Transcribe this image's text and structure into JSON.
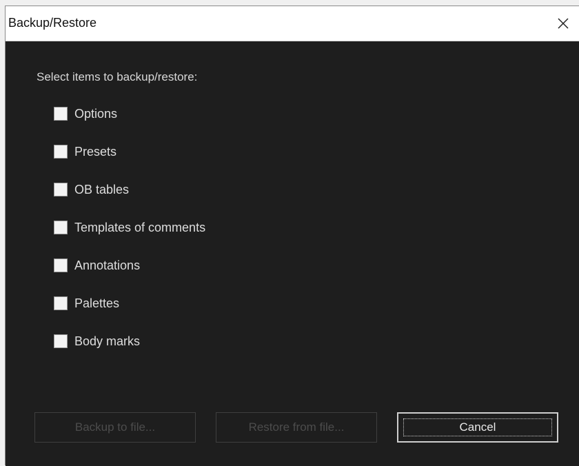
{
  "window": {
    "title": "Backup/Restore",
    "close_icon": "close-icon"
  },
  "prompt": "Select items to backup/restore:",
  "items": [
    {
      "label": "Options",
      "checked": false
    },
    {
      "label": "Presets",
      "checked": false
    },
    {
      "label": "OB tables",
      "checked": false
    },
    {
      "label": "Templates of comments",
      "checked": false
    },
    {
      "label": "Annotations",
      "checked": false
    },
    {
      "label": "Palettes",
      "checked": false
    },
    {
      "label": "Body marks",
      "checked": false
    }
  ],
  "buttons": {
    "backup_label": "Backup to file...",
    "restore_label": "Restore from file...",
    "cancel_label": "Cancel"
  }
}
